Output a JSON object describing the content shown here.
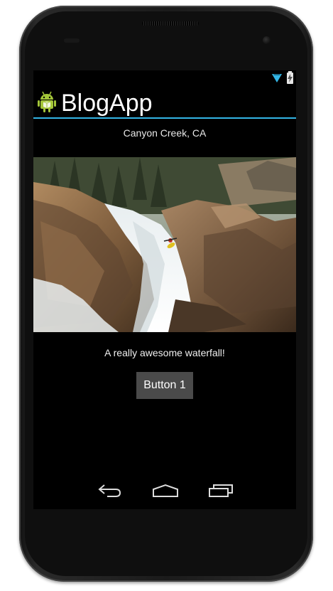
{
  "status_bar": {
    "icons": [
      "wifi-icon",
      "battery-charging-icon"
    ]
  },
  "action_bar": {
    "app_icon": "android-robot-icon",
    "title": "BlogApp",
    "accent_color": "#33b5e5"
  },
  "post": {
    "location": "Canyon Creek, CA",
    "image_description": "kayaker running a waterfall between rocks",
    "caption": "A really awesome waterfall!",
    "button_label": "Button 1"
  },
  "nav_bar": {
    "icons": [
      "back-icon",
      "home-icon",
      "recent-apps-icon"
    ]
  }
}
